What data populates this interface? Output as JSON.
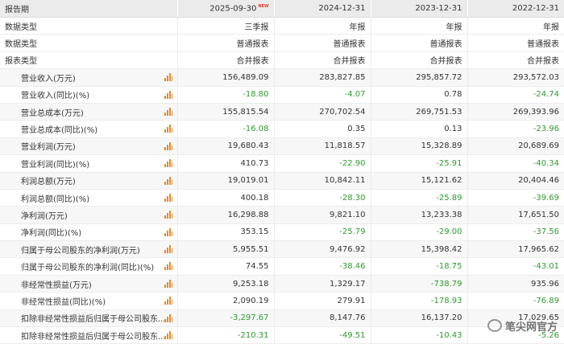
{
  "header": {
    "label": "报告期",
    "new_badge": "NEW",
    "periods": [
      "2025-09-30",
      "2024-12-31",
      "2023-12-31",
      "2022-12-31"
    ]
  },
  "meta_rows": [
    {
      "label": "数据类型",
      "values": [
        "三季报",
        "年报",
        "年报",
        "年报"
      ]
    },
    {
      "label": "数据类型",
      "values": [
        "普通报表",
        "普通报表",
        "普通报表",
        "普通报表"
      ]
    },
    {
      "label": "报表类型",
      "values": [
        "合并报表",
        "合并报表",
        "合并报表",
        "合并报表"
      ]
    }
  ],
  "rows": [
    {
      "label": "营业收入(万元)",
      "values": [
        "156,489.09",
        "283,827.85",
        "295,857.72",
        "293,572.03"
      ]
    },
    {
      "label": "营业收入(同比)(%)",
      "values": [
        "-18.80",
        "-4.07",
        "0.78",
        "-24.74"
      ]
    },
    {
      "label": "营业总成本(万元)",
      "values": [
        "155,815.54",
        "270,702.54",
        "269,751.53",
        "269,393.96"
      ]
    },
    {
      "label": "营业总成本(同比)(%)",
      "values": [
        "-16.08",
        "0.35",
        "0.13",
        "-23.96"
      ]
    },
    {
      "label": "营业利润(万元)",
      "values": [
        "19,680.43",
        "11,818.57",
        "15,328.89",
        "20,689.69"
      ]
    },
    {
      "label": "营业利润(同比)(%)",
      "values": [
        "410.73",
        "-22.90",
        "-25.91",
        "-40.34"
      ]
    },
    {
      "label": "利润总额(万元)",
      "values": [
        "19,019.01",
        "10,842.11",
        "15,121.62",
        "20,404.46"
      ]
    },
    {
      "label": "利润总额(同比)(%)",
      "values": [
        "400.18",
        "-28.30",
        "-25.89",
        "-39.69"
      ]
    },
    {
      "label": "净利润(万元)",
      "values": [
        "16,298.88",
        "9,821.10",
        "13,233.38",
        "17,651.50"
      ]
    },
    {
      "label": "净利润(同比)(%)",
      "values": [
        "353.15",
        "-25.79",
        "-29.00",
        "-37.56"
      ]
    },
    {
      "label": "归属于母公司股东的净利润(万元)",
      "values": [
        "5,955.51",
        "9,476.92",
        "15,398.42",
        "17,965.62"
      ]
    },
    {
      "label": "归属于母公司股东的净利润(同比)(%)",
      "values": [
        "74.55",
        "-38.46",
        "-18.75",
        "-43.01"
      ]
    },
    {
      "label": "非经常性损益(万元)",
      "values": [
        "9,253.18",
        "1,329.17",
        "-738.79",
        "935.96"
      ]
    },
    {
      "label": "非经常性损益(同比)(%)",
      "values": [
        "2,090.19",
        "279.91",
        "-178.93",
        "-76.89"
      ]
    },
    {
      "label": "扣除非经常性损益后归属于母公司股东...",
      "values": [
        "-3,297.67",
        "8,147.76",
        "16,137.20",
        "17,029.65"
      ]
    },
    {
      "label": "扣除非经常性损益后归属于母公司股东...",
      "values": [
        "-210.31",
        "-49.51",
        "-10.43",
        "-5.26"
      ]
    }
  ],
  "icons": {
    "row_chart": "bar-chart-icon"
  },
  "colors": {
    "negative": "#2f9a2f",
    "header_bg": "#ebebeb",
    "icon": "#e58a2a",
    "badge": "#e23a2c"
  },
  "watermark": {
    "text": "笔尖网官方"
  }
}
